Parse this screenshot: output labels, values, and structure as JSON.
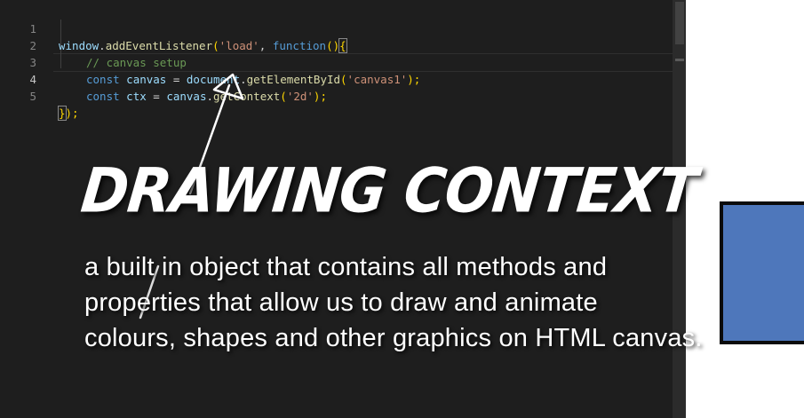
{
  "editor": {
    "active_line": 4,
    "lines": [
      {
        "number": "1"
      },
      {
        "number": "2"
      },
      {
        "number": "3"
      },
      {
        "number": "4"
      },
      {
        "number": "5"
      }
    ],
    "tokens": {
      "l1": {
        "window": "window",
        "dot": ".",
        "method": "addEventListener",
        "open": "(",
        "load": "'load'",
        "comma": ", ",
        "function": "function",
        "parens": "()",
        "brace": "{"
      },
      "l2": {
        "comment": "// canvas setup"
      },
      "l3": {
        "const": "const",
        "name": "canvas",
        "eq": " = ",
        "document": "document",
        "dot": ".",
        "method": "getElementById",
        "open": "(",
        "arg": "'canvas1'",
        "close": ");"
      },
      "l4": {
        "const": "const",
        "name": "ctx",
        "eq": " = ",
        "canvas": "canvas",
        "dot": ".",
        "method": "getContext",
        "open": "(",
        "arg": "'2d'",
        "close": ");"
      },
      "l5": {
        "brace": "}",
        "close": ");"
      }
    }
  },
  "overlay": {
    "title": "DRAWING CONTEXT",
    "caption_lines": [
      "a built in object that contains all methods and",
      "properties that allow us to draw and animate",
      "colours, shapes and other graphics on HTML canvas."
    ]
  },
  "preview": {
    "rect_fill": "#4e77bb",
    "rect_border": "#0b0b0b"
  },
  "colors": {
    "editor_bg": "#1e1e1e",
    "keyword": "#569cd6",
    "string": "#ce9178",
    "function": "#dcdcaa",
    "variable": "#9cdcfe",
    "comment": "#6a9955"
  }
}
